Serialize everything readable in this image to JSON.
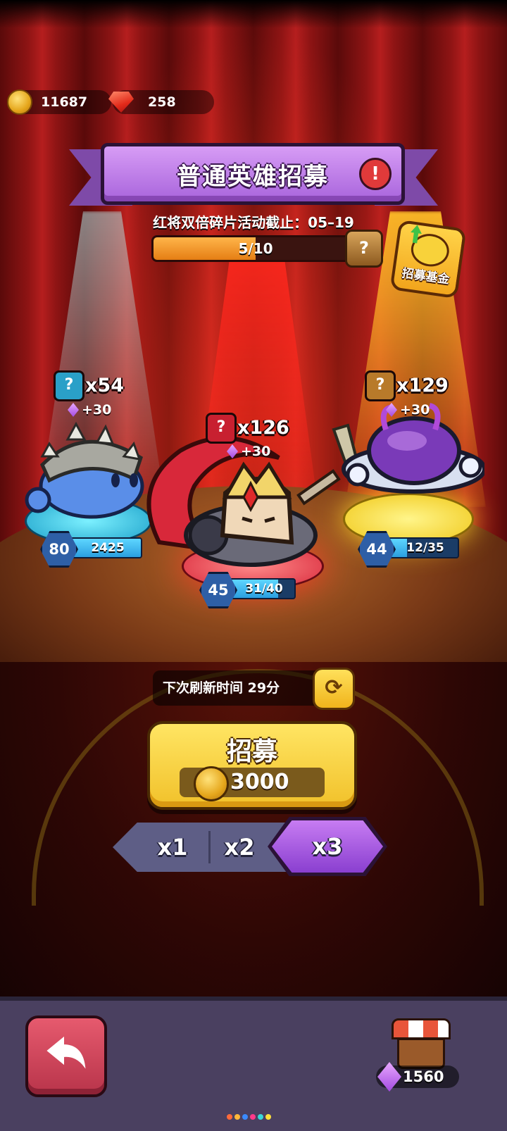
{
  "currency": {
    "coins": "11687",
    "gems": "258"
  },
  "banner": {
    "title": "普通英雄招募",
    "alert_symbol": "!",
    "event_text": "红将双倍碎片活动截止：05–19",
    "progress_text": "5/10",
    "progress_fraction": 0.5,
    "chest_symbol": "?"
  },
  "fund": {
    "label": "招募基金"
  },
  "heroes": [
    {
      "badge": "?",
      "count": "x54",
      "bonus": "+30",
      "level": "80",
      "shards": "2425",
      "shard_fraction": 1.0,
      "color": "#2aa0c8"
    },
    {
      "badge": "?",
      "count": "x126",
      "bonus": "+30",
      "level": "45",
      "shards": "31/40",
      "shard_fraction": 0.775,
      "color": "#d8283a"
    },
    {
      "badge": "?",
      "count": "x129",
      "bonus": "+30",
      "level": "44",
      "shards": "12/35",
      "shard_fraction": 0.343,
      "color": "#b87a2a"
    }
  ],
  "refresh": {
    "text": "下次刷新时间 29分",
    "icon": "refresh-icon"
  },
  "recruit": {
    "label": "招募",
    "cost": "3000"
  },
  "multipliers": {
    "options": [
      "x1",
      "x2",
      "x3"
    ],
    "selected": "x3"
  },
  "bottom": {
    "shop_gems": "1560"
  },
  "colors": {
    "accent_purple": "#a864dc",
    "gold": "#f1c12a",
    "back_button": "#d04a5e"
  }
}
